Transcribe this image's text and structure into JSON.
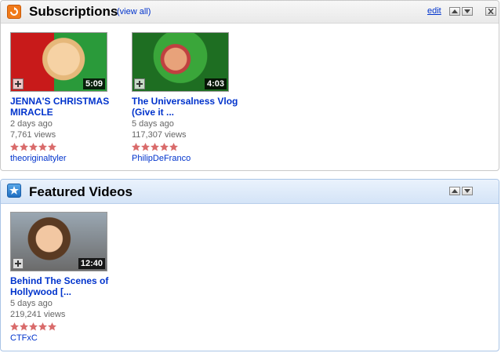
{
  "subscriptions": {
    "title": "Subscriptions",
    "view_all": "(view all)",
    "edit": "edit",
    "videos": [
      {
        "title": "JENNA'S CHRISTMAS MIRACLE",
        "age": "2 days ago",
        "views": "7,761 views",
        "duration": "5:09",
        "user": "theoriginaltyler",
        "rating": 5
      },
      {
        "title": "The Universalness Vlog (Give it ...",
        "age": "5 days ago",
        "views": "117,307 views",
        "duration": "4:03",
        "user": "PhilipDeFranco",
        "rating": 5
      }
    ]
  },
  "featured": {
    "title": "Featured Videos",
    "videos": [
      {
        "title": "Behind The Scenes of Hollywood [...",
        "age": "5 days ago",
        "views": "219,241 views",
        "duration": "12:40",
        "user": "CTFxC",
        "rating": 5
      }
    ]
  },
  "colors": {
    "link": "#0033cc",
    "star": "#d96b6b",
    "subs_icon": "#f07a1a",
    "feat_icon": "#1f6fc2"
  }
}
